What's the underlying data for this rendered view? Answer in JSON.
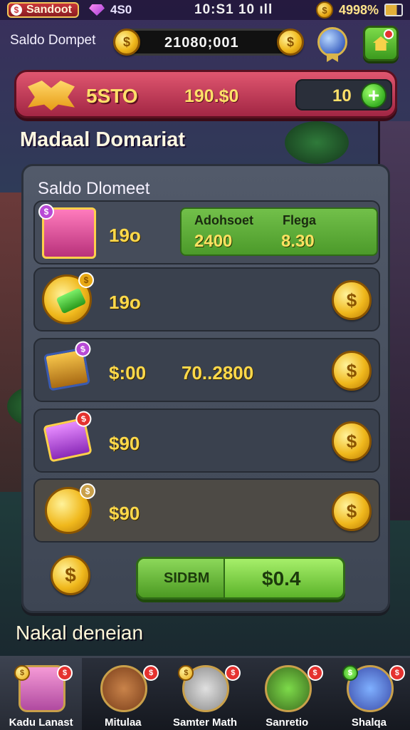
{
  "status_bar": {
    "app_icon": "$",
    "app_name": "Sandoot",
    "left_text": "4S0",
    "time": "10:S1 10 ıll",
    "coin_icon": "$",
    "percent": "4998%"
  },
  "wallet": {
    "label": "Saldo Dompet",
    "value": "21080;001",
    "coin_icon": "$"
  },
  "banner": {
    "label": "5STO",
    "amount": "190.$0",
    "count": "10",
    "plus_label": "+"
  },
  "section_title": "Madaal Domariat",
  "panel": {
    "title": "Saldo Dlomeet",
    "rows": [
      {
        "value": "19o",
        "card": {
          "h1": "Adohsoet",
          "h2": "Flega",
          "v1": "2400",
          "v2": "8.30"
        },
        "tag": "$"
      },
      {
        "value": "19o",
        "coin": "$",
        "tag": "$"
      },
      {
        "value": "$:00",
        "mid": "70..2800",
        "coin": "$",
        "tag": "$"
      },
      {
        "value": "$90",
        "coin": "$",
        "tag": "$"
      },
      {
        "value": "$90",
        "coin": "$",
        "tag": "$"
      }
    ],
    "footer_coin": "$",
    "redeem_left": "SIDBM",
    "redeem_right": "$0.4"
  },
  "bottom_title": "Nakal deneian",
  "nav": {
    "items": [
      {
        "label": "Kadu Lanast",
        "badge": "$",
        "coin": "$"
      },
      {
        "label": "Mitulaa",
        "badge": "$"
      },
      {
        "label": "Samter Math",
        "badge": "$",
        "coin": "$"
      },
      {
        "label": "Sanretio",
        "badge": "$"
      },
      {
        "label": "Shalqa",
        "badge": "$",
        "coin": "$"
      }
    ]
  },
  "colors": {
    "accent_gold": "#ffd94a",
    "banner_red": "#c23a56",
    "button_green": "#5cb32a"
  }
}
